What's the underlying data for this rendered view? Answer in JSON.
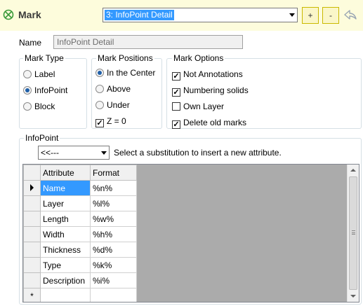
{
  "header": {
    "title": "Mark",
    "mark_icon": "circle-x-icon",
    "selected_mark": "3: InfoPoint Detail",
    "add_label": "+",
    "remove_label": "-",
    "back_icon": "back-arrow-icon",
    "accent_color": "#fdfcdc"
  },
  "name": {
    "label": "Name",
    "value": "InfoPoint Detail"
  },
  "mark_type": {
    "title": "Mark Type",
    "options": [
      "Label",
      "InfoPoint",
      "Block"
    ],
    "selected": "InfoPoint"
  },
  "mark_positions": {
    "title": "Mark Positions",
    "options": [
      "In the Center",
      "Above",
      "Under"
    ],
    "selected": "In the Center",
    "z_zero_label": "Z = 0",
    "z_zero_checked": true
  },
  "mark_options": {
    "title": "Mark Options",
    "items": [
      {
        "label": "Not Annotations",
        "checked": true
      },
      {
        "label": "Numbering solids",
        "checked": true
      },
      {
        "label": "Own Layer",
        "checked": false
      },
      {
        "label": "Delete old marks",
        "checked": true
      }
    ]
  },
  "infopoint": {
    "title": "InfoPoint",
    "substitution_value": "<<---",
    "hint": "Select a substitution to insert a new attribute.",
    "columns": [
      "Attribute",
      "Format"
    ],
    "rows": [
      {
        "attribute": "Name",
        "format": "%n%"
      },
      {
        "attribute": "Layer",
        "format": "%l%"
      },
      {
        "attribute": "Length",
        "format": "%w%"
      },
      {
        "attribute": "Width",
        "format": "%h%"
      },
      {
        "attribute": "Thickness",
        "format": "%d%"
      },
      {
        "attribute": "Type",
        "format": "%k%"
      },
      {
        "attribute": "Description",
        "format": "%i%"
      }
    ],
    "new_row_marker": "*",
    "selected_color": "#3399ff"
  }
}
